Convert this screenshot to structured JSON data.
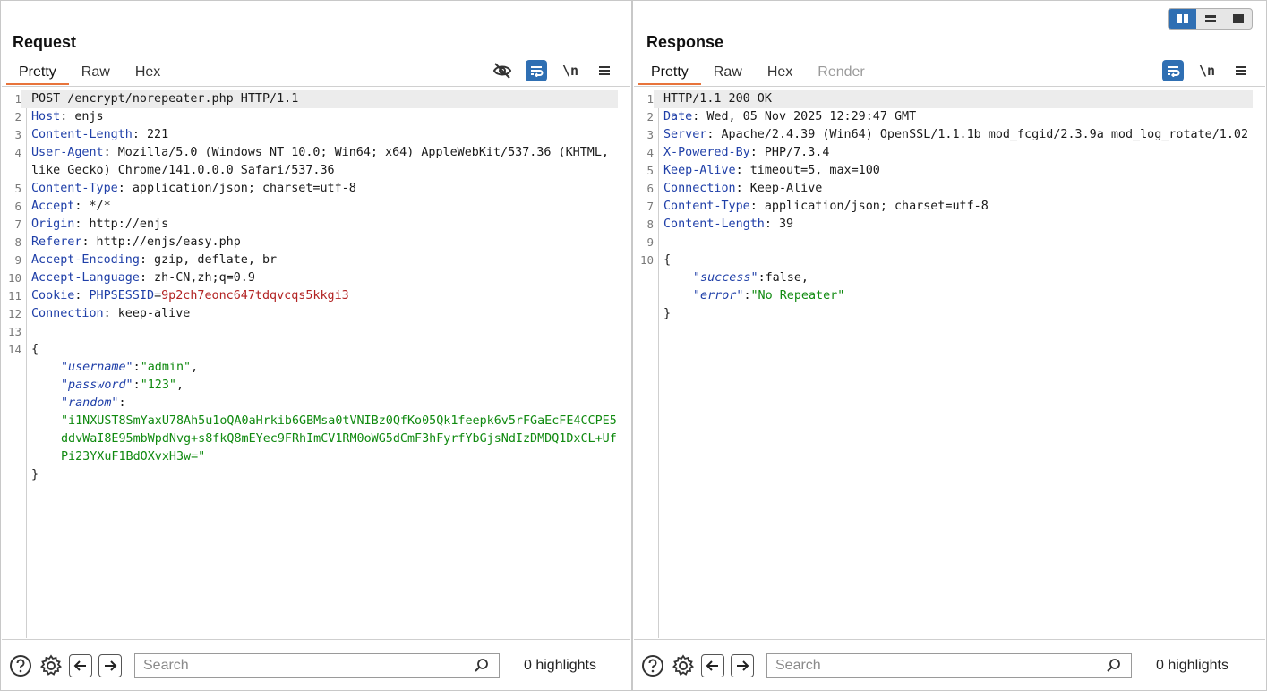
{
  "request": {
    "title": "Request",
    "tabs": [
      "Pretty",
      "Raw",
      "Hex"
    ],
    "lines": [
      {
        "n": "1",
        "parts": [
          {
            "t": "POST /encrypt/norepeater.php HTTP/1.1",
            "c": ""
          }
        ]
      },
      {
        "n": "2",
        "parts": [
          {
            "t": "Host",
            "c": "hk"
          },
          {
            "t": ": enjs",
            "c": ""
          }
        ]
      },
      {
        "n": "3",
        "parts": [
          {
            "t": "Content-Length",
            "c": "hk"
          },
          {
            "t": ": 221",
            "c": ""
          }
        ]
      },
      {
        "n": "4",
        "parts": [
          {
            "t": "User-Agent",
            "c": "hk"
          },
          {
            "t": ": Mozilla/5.0 (Windows NT 10.0; Win64; x64) AppleWebKit/537.36 (KHTML, like Gecko) Chrome/141.0.0.0 Safari/537.36",
            "c": ""
          }
        ]
      },
      {
        "n": "5",
        "parts": [
          {
            "t": "Content-Type",
            "c": "hk"
          },
          {
            "t": ": application/json; charset=utf-8",
            "c": ""
          }
        ]
      },
      {
        "n": "6",
        "parts": [
          {
            "t": "Accept",
            "c": "hk"
          },
          {
            "t": ": */*",
            "c": ""
          }
        ]
      },
      {
        "n": "7",
        "parts": [
          {
            "t": "Origin",
            "c": "hk"
          },
          {
            "t": ": http://enjs",
            "c": ""
          }
        ]
      },
      {
        "n": "8",
        "parts": [
          {
            "t": "Referer",
            "c": "hk"
          },
          {
            "t": ": http://enjs/easy.php",
            "c": ""
          }
        ]
      },
      {
        "n": "9",
        "parts": [
          {
            "t": "Accept-Encoding",
            "c": "hk"
          },
          {
            "t": ": gzip, deflate, br",
            "c": ""
          }
        ]
      },
      {
        "n": "10",
        "parts": [
          {
            "t": "Accept-Language",
            "c": "hk"
          },
          {
            "t": ": zh-CN,zh;q=0.9",
            "c": ""
          }
        ]
      },
      {
        "n": "11",
        "parts": [
          {
            "t": "Cookie",
            "c": "hk"
          },
          {
            "t": ": ",
            "c": ""
          },
          {
            "t": "PHPSESSID",
            "c": "hk"
          },
          {
            "t": "=",
            "c": ""
          },
          {
            "t": "9p2ch7eonc647tdqvcqs5kkgi3",
            "c": "sv"
          }
        ]
      },
      {
        "n": "12",
        "parts": [
          {
            "t": "Connection",
            "c": "hk"
          },
          {
            "t": ": keep-alive",
            "c": ""
          }
        ]
      },
      {
        "n": "13",
        "parts": [
          {
            "t": "",
            "c": ""
          }
        ]
      },
      {
        "n": "14",
        "parts": [
          {
            "t": "{",
            "c": ""
          }
        ]
      },
      {
        "n": "",
        "indent": true,
        "parts": [
          {
            "t": "\"username\"",
            "c": "jk"
          },
          {
            "t": ":",
            "c": ""
          },
          {
            "t": "\"admin\"",
            "c": "jv"
          },
          {
            "t": ",",
            "c": ""
          }
        ]
      },
      {
        "n": "",
        "indent": true,
        "parts": [
          {
            "t": "\"password\"",
            "c": "jk"
          },
          {
            "t": ":",
            "c": ""
          },
          {
            "t": "\"123\"",
            "c": "jv"
          },
          {
            "t": ",",
            "c": ""
          }
        ]
      },
      {
        "n": "",
        "indent": true,
        "parts": [
          {
            "t": "\"random\"",
            "c": "jk"
          },
          {
            "t": ":",
            "c": ""
          }
        ]
      },
      {
        "n": "",
        "indent": true,
        "parts": [
          {
            "t": "\"i1NXUST8SmYaxU78Ah5u1oQA0aHrkib6GBMsa0tVNIBz0QfKo05Qk1feepk6v5rFGaEcFE4CCPE5ddvWaI8E95mbWpdNvg+s8fkQ8mEYec9FRhImCV1RM0oWG5dCmF3hFyrfYbGjsNdIzDMDQ1DxCL+UfPi23YXuF1BdOXvxH3w=\"",
            "c": "jv"
          }
        ]
      },
      {
        "n": "",
        "parts": [
          {
            "t": "}",
            "c": ""
          }
        ]
      }
    ],
    "search_placeholder": "Search",
    "highlights": "0 highlights"
  },
  "response": {
    "title": "Response",
    "tabs": [
      "Pretty",
      "Raw",
      "Hex",
      "Render"
    ],
    "lines": [
      {
        "n": "1",
        "parts": [
          {
            "t": "HTTP/1.1 200 OK",
            "c": ""
          }
        ]
      },
      {
        "n": "2",
        "parts": [
          {
            "t": "Date",
            "c": "hk"
          },
          {
            "t": ": Wed, 05 Nov 2025 12:29:47 GMT",
            "c": ""
          }
        ]
      },
      {
        "n": "3",
        "parts": [
          {
            "t": "Server",
            "c": "hk"
          },
          {
            "t": ": Apache/2.4.39 (Win64) OpenSSL/1.1.1b mod_fcgid/2.3.9a mod_log_rotate/1.02",
            "c": ""
          }
        ]
      },
      {
        "n": "4",
        "parts": [
          {
            "t": "X-Powered-By",
            "c": "hk"
          },
          {
            "t": ": PHP/7.3.4",
            "c": ""
          }
        ]
      },
      {
        "n": "5",
        "parts": [
          {
            "t": "Keep-Alive",
            "c": "hk"
          },
          {
            "t": ": timeout=5, max=100",
            "c": ""
          }
        ]
      },
      {
        "n": "6",
        "parts": [
          {
            "t": "Connection",
            "c": "hk"
          },
          {
            "t": ": Keep-Alive",
            "c": ""
          }
        ]
      },
      {
        "n": "7",
        "parts": [
          {
            "t": "Content-Type",
            "c": "hk"
          },
          {
            "t": ": application/json; charset=utf-8",
            "c": ""
          }
        ]
      },
      {
        "n": "8",
        "parts": [
          {
            "t": "Content-Length",
            "c": "hk"
          },
          {
            "t": ": 39",
            "c": ""
          }
        ]
      },
      {
        "n": "9",
        "parts": [
          {
            "t": "",
            "c": ""
          }
        ]
      },
      {
        "n": "10",
        "parts": [
          {
            "t": "{",
            "c": ""
          }
        ]
      },
      {
        "n": "",
        "indent": true,
        "parts": [
          {
            "t": "\"success\"",
            "c": "jk"
          },
          {
            "t": ":false,",
            "c": ""
          }
        ]
      },
      {
        "n": "",
        "indent": true,
        "parts": [
          {
            "t": "\"error\"",
            "c": "jk"
          },
          {
            "t": ":",
            "c": ""
          },
          {
            "t": "\"No Repeater\"",
            "c": "jv"
          }
        ]
      },
      {
        "n": "",
        "parts": [
          {
            "t": "}",
            "c": ""
          }
        ]
      }
    ],
    "search_placeholder": "Search",
    "highlights": "0 highlights"
  },
  "colors": {
    "accent_tab": "#e8743b",
    "button_blue": "#2f6fb3"
  },
  "icons": [
    "help-icon",
    "gear-icon",
    "arrow-left-icon",
    "arrow-right-icon",
    "search-icon",
    "hide-icon",
    "wrap-icon",
    "newline-icon",
    "menu-icon"
  ]
}
